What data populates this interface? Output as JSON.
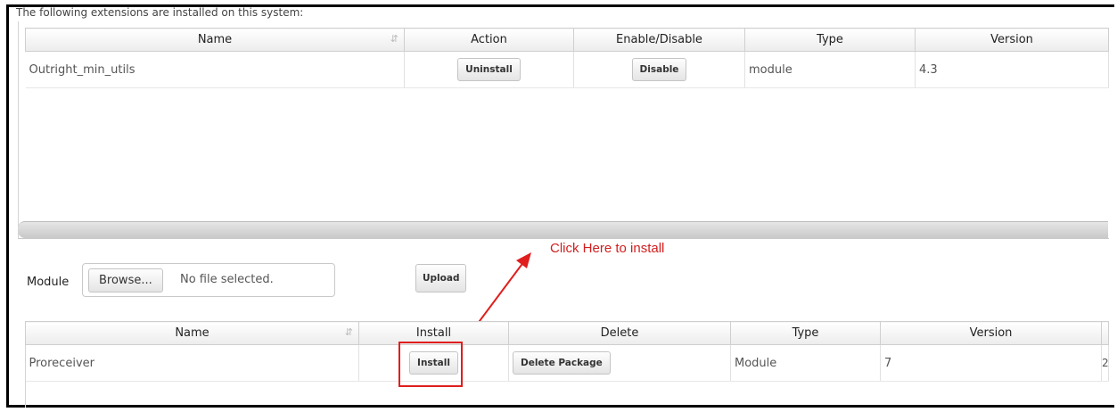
{
  "intro_text": "The following extensions are installed on this system:",
  "installed_table": {
    "headers": [
      "Name",
      "Action",
      "Enable/Disable",
      "Type",
      "Version"
    ],
    "rows": [
      {
        "name": "Outright_min_utils",
        "action": "Uninstall",
        "toggle": "Disable",
        "type": "module",
        "version": "4.3"
      }
    ]
  },
  "upload": {
    "label": "Module",
    "browse_label": "Browse...",
    "no_file_text": "No file selected.",
    "upload_label": "Upload"
  },
  "packages_table": {
    "headers": [
      "Name",
      "Install",
      "Delete",
      "Type",
      "Version"
    ],
    "rows": [
      {
        "name": "Proreceiver",
        "install": "Install",
        "delete": "Delete Package",
        "type": "Module",
        "version": "7",
        "extra": "2"
      }
    ]
  },
  "annotation": {
    "text": "Click Here to install",
    "color": "#d21f1f"
  },
  "icons": {
    "sort": "sort-arrows-icon"
  }
}
